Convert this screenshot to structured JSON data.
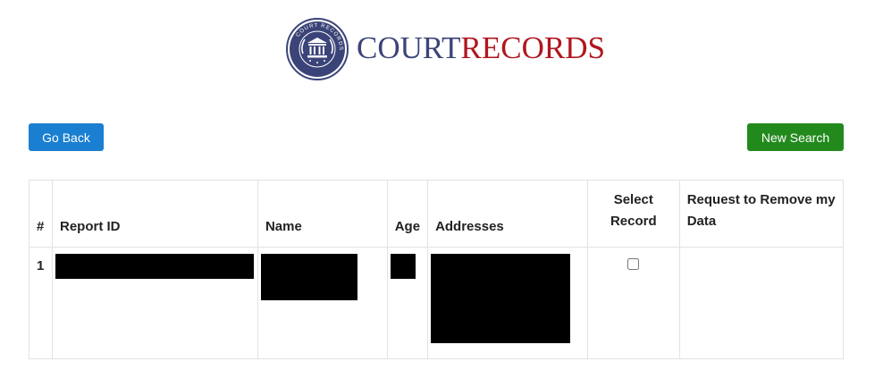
{
  "brand": {
    "part1": "COURT",
    "part2": "RECORDS",
    "seal_text": "COURT RECORDS"
  },
  "buttons": {
    "go_back": "Go Back",
    "new_search": "New Search"
  },
  "table": {
    "headers": {
      "num": "#",
      "report_id": "Report ID",
      "name": "Name",
      "age": "Age",
      "addresses": "Addresses",
      "select_record": "Select Record",
      "remove_data": "Request to Remove my Data"
    },
    "rows": [
      {
        "num": "1",
        "selected": false
      }
    ]
  },
  "colors": {
    "brand_blue": "#3b4478",
    "brand_red": "#b0161e",
    "go_back_button": "#1a7fd1",
    "new_search_button": "#228a1d"
  }
}
